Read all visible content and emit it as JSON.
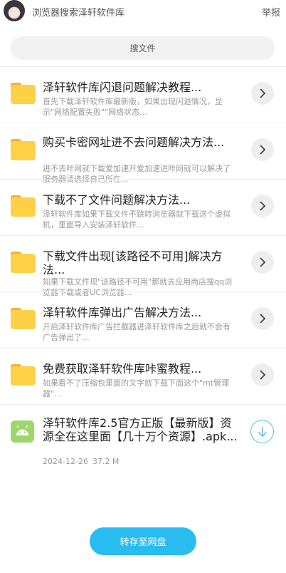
{
  "header": {
    "title": "浏览器搜索泽轩软件库",
    "report_label": "举报"
  },
  "search": {
    "label": "搜文件"
  },
  "files": [
    {
      "title": "泽轩软件库闪退问题解决教程...",
      "desc": "首先下载泽轩软件库最新版，如果出现闪退情况，显示\"网络配置失败\"\"网络状态..."
    },
    {
      "title": "购买卡密网址进不去问题解决方法...",
      "desc": "进不去咔网就下载爱加速开爱加速进咔网就可以解决了 服务器请选择自己所在..."
    },
    {
      "title": "下载不了文件问题解决方法...",
      "desc": "泽轩软件库如果下载文件不跳转浏览器就下载这个虚拟机，里面导入安装泽轩软件..."
    },
    {
      "title": "下载文件出现[该路径不可用]解决方法...",
      "desc": "如果下载文件现\"该路径不可用\"那就去应用商店搜qq浏览器下载或者UC浏览器..."
    },
    {
      "title": "泽轩软件库弹出广告解决方法...",
      "desc": "开启泽轩软件库广告拦截器进泽轩软件库之后就不会有广告弹出了..."
    },
    {
      "title": "免费获取泽轩软件库咔蜜教程...",
      "desc": "如果看不了压缩包里面的文字就下载下面这个\"mt管理器\"..."
    }
  ],
  "apk": {
    "title": "泽轩软件库2.5官方正版【最新版】资源全在这里面【几十万个资源】.apk...",
    "date": "2024-12-26",
    "size": "37.2 M"
  },
  "save_button": {
    "label": "转存至网盘"
  },
  "colors": {
    "accent": "#29bcf0",
    "folder": "#fdd046",
    "apk": "#9fd66b"
  }
}
